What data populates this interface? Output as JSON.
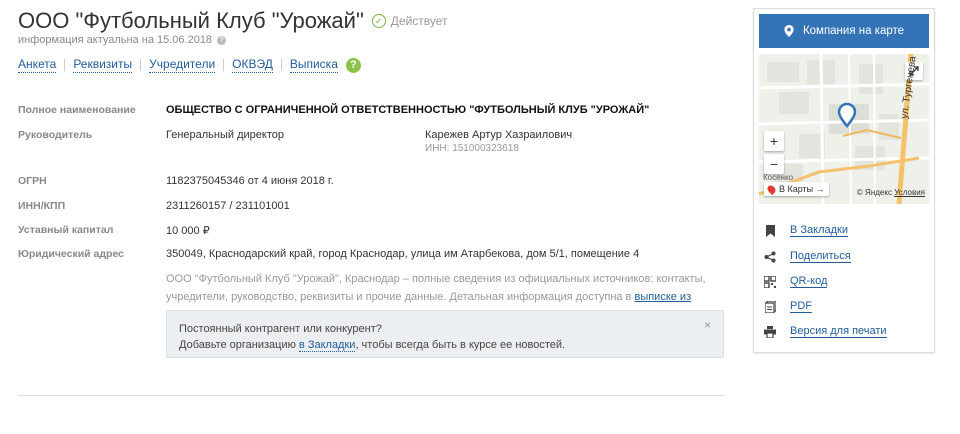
{
  "header": {
    "title": "ООО \"Футбольный Клуб \"Урожай\"",
    "status": "Действует",
    "actuality": "информация актуальна на 15.06.2018"
  },
  "tabs": [
    "Анкета",
    "Реквизиты",
    "Учредители",
    "ОКВЭД",
    "Выписка"
  ],
  "help_label": "?",
  "details": {
    "full_name_label": "Полное наименование",
    "full_name": "ОБЩЕСТВО С ОГРАНИЧЕННОЙ ОТВЕТСТВЕННОСТЬЮ \"ФУТБОЛЬНЫЙ КЛУБ \"УРОЖАЙ\"",
    "director_label": "Руководитель",
    "director_title": "Генеральный директор",
    "director_name": "Карежев Артур Хазраилович",
    "director_inn": "ИНН: 151000323618",
    "ogrn_label": "ОГРН",
    "ogrn": "1182375045346 от 4 июня 2018 г.",
    "inn_kpp_label": "ИНН/КПП",
    "inn_kpp": "2311260157 / 231101001",
    "capital_label": "Уставный капитал",
    "capital": "10 000 ₽",
    "address_label": "Юридический адрес",
    "address": "350049, Краснодарский край, город Краснодар, улица им Атарбекова, дом 5/1, помещение 4"
  },
  "description": {
    "text": "ООО \"Футбольный Клуб \"Урожай\", Краснодар – полные сведения из официальных источников: контакты, учредители, руководство, реквизиты и прочие данные. Детальная информация доступна в",
    "link": "выписке из ЕГРЮЛ",
    "end": "."
  },
  "notice": {
    "line1": "Постоянный контрагент или конкурент?",
    "line2_start": "Добавьте организацию",
    "line2_link": "в Закладки",
    "line2_end": ", чтобы всегда быть в курсе ее новостей.",
    "close": "×"
  },
  "sidebar": {
    "map_button": "Компания на карте",
    "map": {
      "street_label": "ул. Тургенева",
      "district_label": "Косенко",
      "zoom_in": "+",
      "zoom_out": "−",
      "open_maps": "В Карты →",
      "copyright": "© Яндекс",
      "terms": "Условия"
    },
    "links": [
      {
        "label": "В Закладки",
        "icon": "bookmark-icon"
      },
      {
        "label": "Поделиться",
        "icon": "share-icon"
      },
      {
        "label": "QR-код",
        "icon": "qr-code-icon"
      },
      {
        "label": "PDF",
        "icon": "pdf-icon"
      },
      {
        "label": "Версия для печати",
        "icon": "print-icon"
      }
    ]
  },
  "colors": {
    "accent": "#3473b6",
    "link": "#1f5c99",
    "status_green": "#7cb342",
    "help_green": "#8bc34a",
    "notice_bg": "#eceff1"
  }
}
